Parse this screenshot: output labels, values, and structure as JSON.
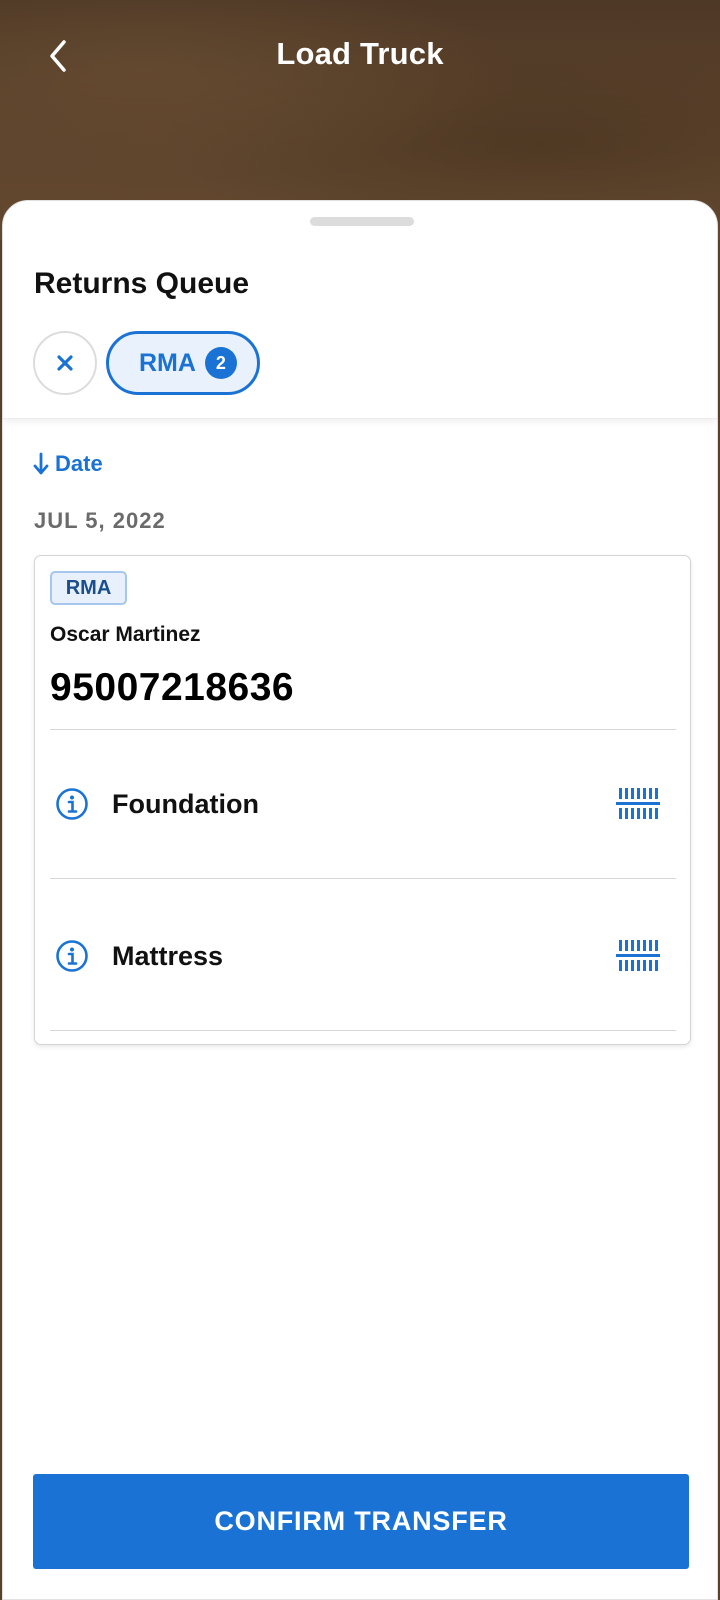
{
  "header": {
    "title": "Load Truck",
    "back_icon": "chevron-left-icon"
  },
  "queue": {
    "title": "Returns Queue",
    "clear_icon": "close-icon",
    "filter_chip": {
      "label": "RMA",
      "count": "2"
    }
  },
  "sort": {
    "label": "Date",
    "icon": "arrow-down-icon"
  },
  "group": {
    "date": "JUL 5, 2022",
    "order": {
      "tag": "RMA",
      "customer": "Oscar Martinez",
      "number": "95007218636",
      "items": [
        {
          "name": "Foundation",
          "info_icon": "info-icon",
          "action_icon": "barcode-scan-icon"
        },
        {
          "name": "Mattress",
          "info_icon": "info-icon",
          "action_icon": "barcode-scan-icon"
        }
      ]
    }
  },
  "footer": {
    "confirm_label": "CONFIRM TRANSFER"
  },
  "colors": {
    "accent": "#1a73d4",
    "chip_bg": "#e9f2fc",
    "tag_border": "#a7c6ec"
  }
}
